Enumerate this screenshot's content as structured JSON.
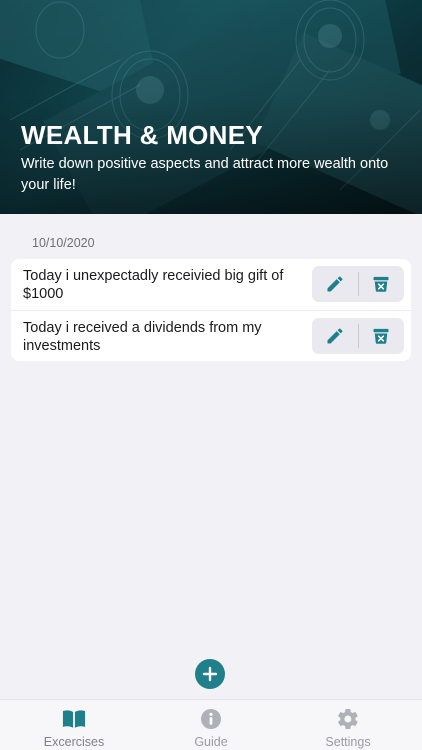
{
  "header": {
    "title": "WEALTH & MONEY",
    "subtitle": "Write down positive aspects and attract more wealth onto your life!",
    "background_image": "dollar-bills-photo"
  },
  "journal": {
    "date": "10/10/2020",
    "entries": [
      {
        "text": "Today i unexpectadly receivied big gift of $1000",
        "edit_icon": "pencil-icon",
        "delete_icon": "trash-icon"
      },
      {
        "text": "Today i received a dividends from my investments",
        "edit_icon": "pencil-icon",
        "delete_icon": "trash-icon"
      }
    ]
  },
  "fab": {
    "icon": "plus-icon"
  },
  "tabbar": {
    "tabs": [
      {
        "label": "Excercises",
        "icon": "book-icon",
        "active": true
      },
      {
        "label": "Guide",
        "icon": "info-icon",
        "active": false
      },
      {
        "label": "Settings",
        "icon": "gear-icon",
        "active": false
      }
    ]
  },
  "colors": {
    "accent": "#1f7f8b",
    "background": "#f1f1f6",
    "card": "#ffffff",
    "action_bg": "#e9e9ef",
    "tab_inactive": "#b0b0b8"
  }
}
